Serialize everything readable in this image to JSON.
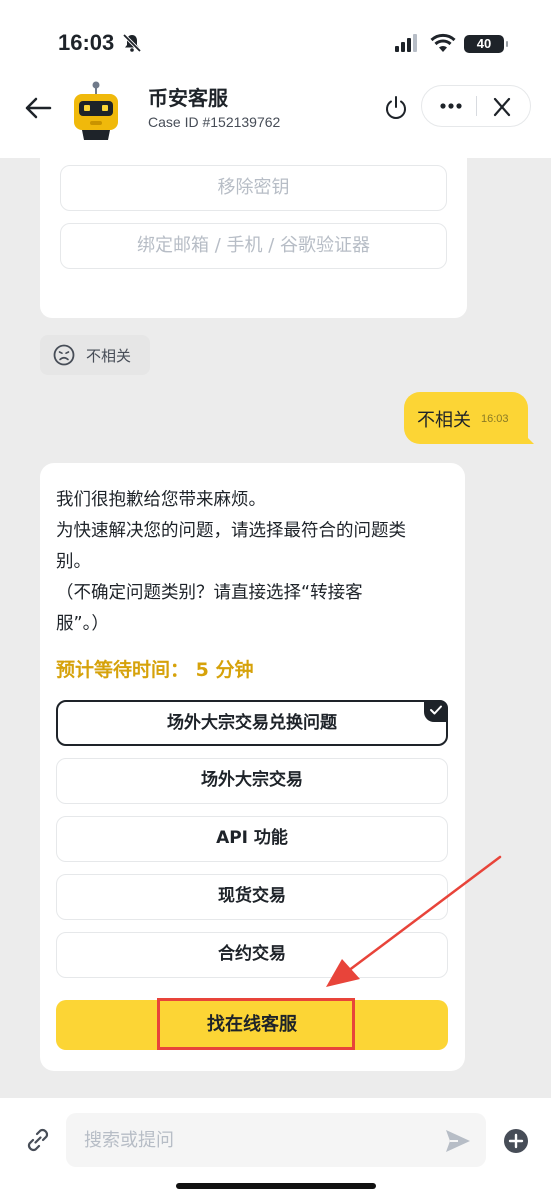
{
  "status_bar": {
    "time": "16:03",
    "battery": "40"
  },
  "header": {
    "agent_name": "币安客服",
    "case_id": "Case ID #152139762"
  },
  "chat": {
    "prev_options": [
      "移除密钥",
      "绑定邮箱 / 手机 / 谷歌验证器"
    ],
    "feedback_label": "不相关",
    "user_message": {
      "text": "不相关",
      "time": "16:03"
    },
    "bot_message": {
      "lines": [
        "我们很抱歉给您带来麻烦。",
        "为快速解决您的问题，请选择最符合的问题类",
        "别。",
        "（不确定问题类别？请直接选择“转接客",
        "服”。）"
      ],
      "wait_time": "预计等待时间： 5 分钟",
      "options": [
        "场外大宗交易兑换问题",
        "场外大宗交易",
        "API 功能",
        "现货交易",
        "合约交易"
      ],
      "selected_option": "场外大宗交易兑换问题",
      "cta_label": "找在线客服"
    }
  },
  "composer": {
    "placeholder": "搜索或提问"
  },
  "colors": {
    "brand_yellow": "#fcd535",
    "wait_time": "#d6a20a",
    "highlight_red": "#e8443a",
    "chat_bg": "#ececec"
  },
  "icons": [
    "back-arrow-icon",
    "robot-avatar-icon",
    "power-icon",
    "more-icon",
    "close-icon",
    "sad-face-icon",
    "check-icon",
    "link-icon",
    "send-icon",
    "add-icon",
    "bell-off-icon",
    "signal-icon",
    "wifi-icon"
  ]
}
